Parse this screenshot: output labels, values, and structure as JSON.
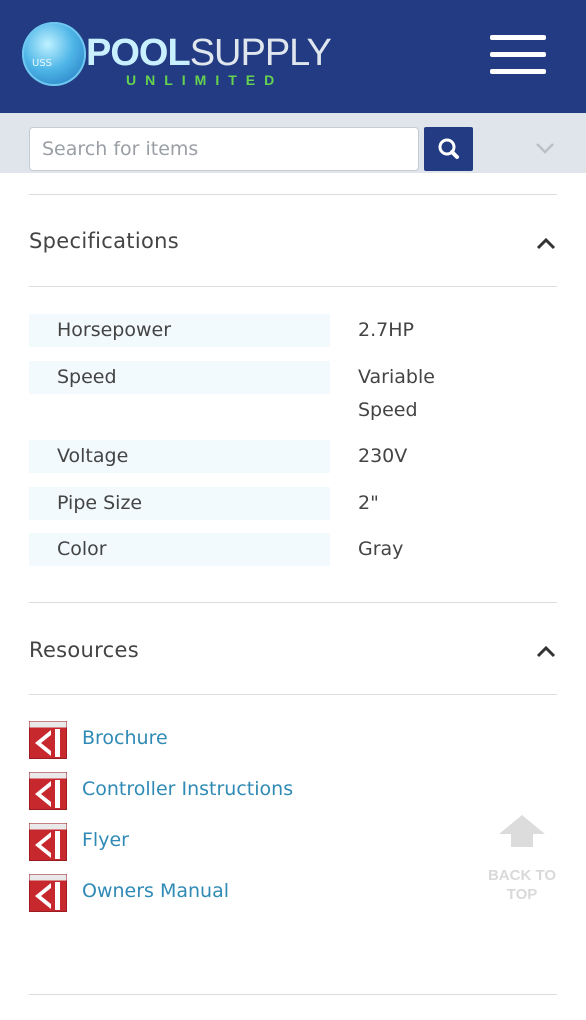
{
  "header": {
    "logo_primary": "POOL",
    "logo_secondary": "SUPPLY",
    "logo_sub": "UNLIMITED",
    "logo_mark": "USS",
    "brand_color": "#233b83",
    "menu_icon": "hamburger-icon"
  },
  "search": {
    "placeholder": "Search for items",
    "value": "",
    "button_icon": "search-icon"
  },
  "specifications": {
    "title": "Specifications",
    "rows": [
      {
        "label": "Horsepower",
        "value": "2.7HP"
      },
      {
        "label": "Speed",
        "value": "Variable Speed"
      },
      {
        "label": "Voltage",
        "value": "230V"
      },
      {
        "label": "Pipe Size",
        "value": "2\""
      },
      {
        "label": "Color",
        "value": "Gray"
      }
    ]
  },
  "resources": {
    "title": "Resources",
    "items": [
      {
        "label": "Brochure",
        "icon": "pdf-icon"
      },
      {
        "label": "Controller Instructions",
        "icon": "pdf-icon"
      },
      {
        "label": "Flyer",
        "icon": "pdf-icon"
      },
      {
        "label": "Owners Manual",
        "icon": "pdf-icon"
      }
    ]
  },
  "back_to_top": {
    "line1": "BACK TO",
    "line2": "TOP"
  }
}
